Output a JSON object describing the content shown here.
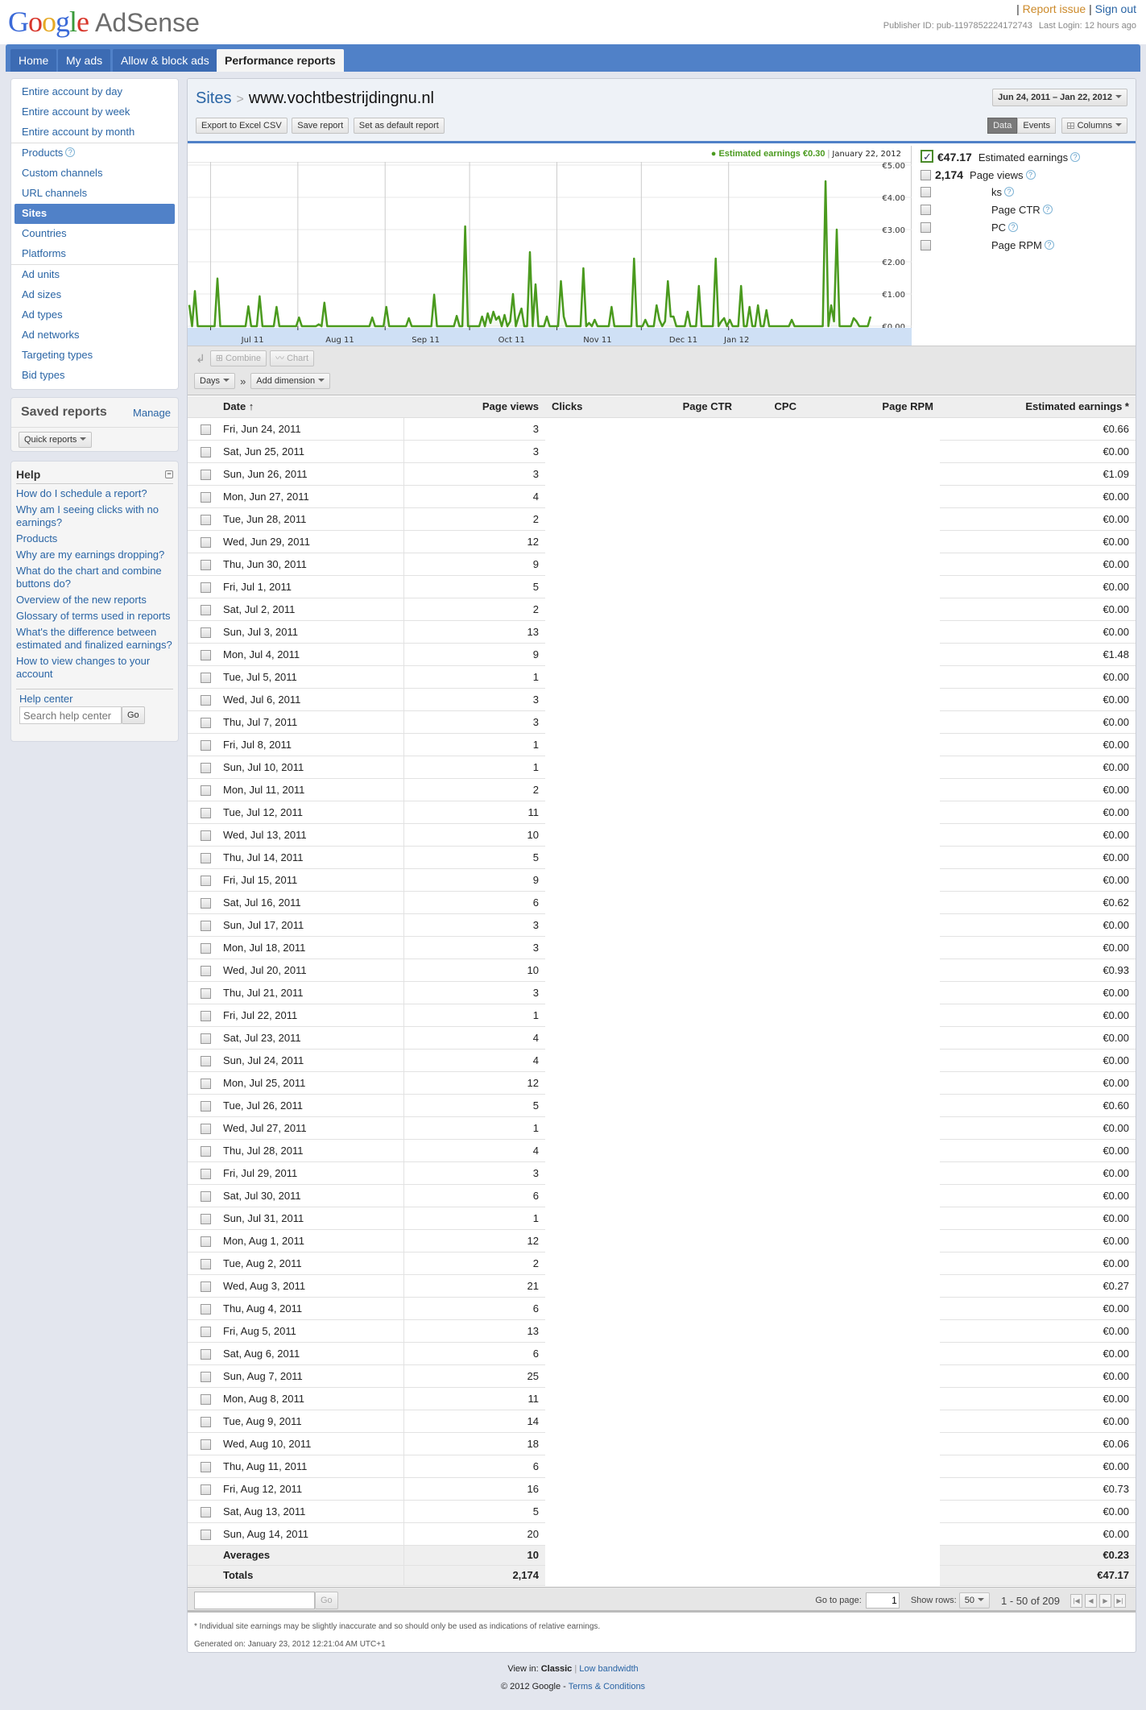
{
  "brand": {
    "google": "Google",
    "product": "AdSense"
  },
  "toplinks": {
    "report_issue": "Report issue",
    "sign_out": "Sign out",
    "publisher_id": "Publisher ID: pub-1197852224172743",
    "last_login": "Last Login: 12 hours ago"
  },
  "tabs": [
    {
      "label": "Home",
      "active": false
    },
    {
      "label": "My ads",
      "active": false
    },
    {
      "label": "Allow & block ads",
      "active": false
    },
    {
      "label": "Performance reports",
      "active": true
    }
  ],
  "sidebar": {
    "groups": [
      [
        "Entire account by day",
        "Entire account by week",
        "Entire account by month"
      ],
      [
        "Products",
        "Custom channels",
        "URL channels",
        "Sites",
        "Countries",
        "Platforms"
      ],
      [
        "Ad units",
        "Ad sizes",
        "Ad types",
        "Ad networks",
        "Targeting types",
        "Bid types"
      ]
    ],
    "active": "Sites",
    "saved_reports": {
      "title": "Saved reports",
      "manage": "Manage",
      "quick_reports": "Quick reports"
    },
    "help": {
      "title": "Help",
      "questions": [
        "How do I schedule a report?",
        "Why am I seeing clicks with no earnings?",
        "Products",
        "Why are my earnings dropping?",
        "What do the chart and combine buttons do?",
        "Overview of the new reports",
        "Glossary of terms used in reports",
        "What's the difference between estimated and finalized earnings?",
        "How to view changes to your account"
      ],
      "help_center": "Help center",
      "search_placeholder": "Search help center",
      "go": "Go"
    }
  },
  "main": {
    "breadcrumb_root": "Sites",
    "breadcrumb_sep": ">",
    "site": "www.vochtbestrijdingnu.nl",
    "actions": [
      "Export to Excel CSV",
      "Save report",
      "Set as default report"
    ],
    "date_range": "Jun 24, 2011 – Jan 22, 2012",
    "view_toggle": [
      "Data",
      "Events"
    ],
    "columns": "Columns",
    "chart_tooltip": {
      "label": "Estimated earnings €0.30",
      "date": "January 22, 2012"
    },
    "metrics": [
      {
        "value": "€47.17",
        "label": "Estimated earnings",
        "checked": true
      },
      {
        "value": "2,174",
        "label": "Page views",
        "checked": false
      },
      {
        "value": "",
        "label": "ks",
        "checked": false
      },
      {
        "value": "",
        "label": "Page CTR",
        "checked": false
      },
      {
        "value": "",
        "label": "PC",
        "checked": false
      },
      {
        "value": "",
        "label": "Page RPM",
        "checked": false
      }
    ],
    "toolbar": {
      "combine": "Combine",
      "chart": "Chart",
      "dimension": "Days",
      "sep": "»",
      "add_dimension": "Add dimension"
    },
    "table": {
      "headers": [
        "Date ↑",
        "Page views",
        "Clicks",
        "Page CTR",
        "CPC",
        "Page RPM",
        "Estimated earnings *"
      ],
      "rows": [
        [
          "Fri, Jun 24, 2011",
          "3",
          "€0.66"
        ],
        [
          "Sat, Jun 25, 2011",
          "3",
          "€0.00"
        ],
        [
          "Sun, Jun 26, 2011",
          "3",
          "€1.09"
        ],
        [
          "Mon, Jun 27, 2011",
          "4",
          "€0.00"
        ],
        [
          "Tue, Jun 28, 2011",
          "2",
          "€0.00"
        ],
        [
          "Wed, Jun 29, 2011",
          "12",
          "€0.00"
        ],
        [
          "Thu, Jun 30, 2011",
          "9",
          "€0.00"
        ],
        [
          "Fri, Jul 1, 2011",
          "5",
          "€0.00"
        ],
        [
          "Sat, Jul 2, 2011",
          "2",
          "€0.00"
        ],
        [
          "Sun, Jul 3, 2011",
          "13",
          "€0.00"
        ],
        [
          "Mon, Jul 4, 2011",
          "9",
          "€1.48"
        ],
        [
          "Tue, Jul 5, 2011",
          "1",
          "€0.00"
        ],
        [
          "Wed, Jul 6, 2011",
          "3",
          "€0.00"
        ],
        [
          "Thu, Jul 7, 2011",
          "3",
          "€0.00"
        ],
        [
          "Fri, Jul 8, 2011",
          "1",
          "€0.00"
        ],
        [
          "Sun, Jul 10, 2011",
          "1",
          "€0.00"
        ],
        [
          "Mon, Jul 11, 2011",
          "2",
          "€0.00"
        ],
        [
          "Tue, Jul 12, 2011",
          "11",
          "€0.00"
        ],
        [
          "Wed, Jul 13, 2011",
          "10",
          "€0.00"
        ],
        [
          "Thu, Jul 14, 2011",
          "5",
          "€0.00"
        ],
        [
          "Fri, Jul 15, 2011",
          "9",
          "€0.00"
        ],
        [
          "Sat, Jul 16, 2011",
          "6",
          "€0.62"
        ],
        [
          "Sun, Jul 17, 2011",
          "3",
          "€0.00"
        ],
        [
          "Mon, Jul 18, 2011",
          "3",
          "€0.00"
        ],
        [
          "Wed, Jul 20, 2011",
          "10",
          "€0.93"
        ],
        [
          "Thu, Jul 21, 2011",
          "3",
          "€0.00"
        ],
        [
          "Fri, Jul 22, 2011",
          "1",
          "€0.00"
        ],
        [
          "Sat, Jul 23, 2011",
          "4",
          "€0.00"
        ],
        [
          "Sun, Jul 24, 2011",
          "4",
          "€0.00"
        ],
        [
          "Mon, Jul 25, 2011",
          "12",
          "€0.00"
        ],
        [
          "Tue, Jul 26, 2011",
          "5",
          "€0.60"
        ],
        [
          "Wed, Jul 27, 2011",
          "1",
          "€0.00"
        ],
        [
          "Thu, Jul 28, 2011",
          "4",
          "€0.00"
        ],
        [
          "Fri, Jul 29, 2011",
          "3",
          "€0.00"
        ],
        [
          "Sat, Jul 30, 2011",
          "6",
          "€0.00"
        ],
        [
          "Sun, Jul 31, 2011",
          "1",
          "€0.00"
        ],
        [
          "Mon, Aug 1, 2011",
          "12",
          "€0.00"
        ],
        [
          "Tue, Aug 2, 2011",
          "2",
          "€0.00"
        ],
        [
          "Wed, Aug 3, 2011",
          "21",
          "€0.27"
        ],
        [
          "Thu, Aug 4, 2011",
          "6",
          "€0.00"
        ],
        [
          "Fri, Aug 5, 2011",
          "13",
          "€0.00"
        ],
        [
          "Sat, Aug 6, 2011",
          "6",
          "€0.00"
        ],
        [
          "Sun, Aug 7, 2011",
          "25",
          "€0.00"
        ],
        [
          "Mon, Aug 8, 2011",
          "11",
          "€0.00"
        ],
        [
          "Tue, Aug 9, 2011",
          "14",
          "€0.00"
        ],
        [
          "Wed, Aug 10, 2011",
          "18",
          "€0.06"
        ],
        [
          "Thu, Aug 11, 2011",
          "6",
          "€0.00"
        ],
        [
          "Fri, Aug 12, 2011",
          "16",
          "€0.73"
        ],
        [
          "Sat, Aug 13, 2011",
          "5",
          "€0.00"
        ],
        [
          "Sun, Aug 14, 2011",
          "20",
          "€0.00"
        ]
      ],
      "averages": {
        "label": "Averages",
        "page_views": "10",
        "earnings": "€0.23"
      },
      "totals": {
        "label": "Totals",
        "page_views": "2,174",
        "earnings": "€47.17"
      }
    },
    "pager": {
      "go": "Go",
      "goto_label": "Go to page:",
      "page": "1",
      "rows_label": "Show rows:",
      "rows": "50",
      "range": "1 - 50 of 209"
    },
    "footnote": "* Individual site earnings may be slightly inaccurate and so should only be used as indications of relative earnings.",
    "generated": "Generated on: January 23, 2012 12:21:04 AM UTC+1"
  },
  "footer": {
    "view_in": "View in:",
    "classic": "Classic",
    "low_bandwidth": "Low bandwidth",
    "copyright": "© 2012 Google -",
    "terms": "Terms & Conditions"
  },
  "chart_data": {
    "type": "line",
    "title": "",
    "series": [
      {
        "name": "Estimated earnings",
        "color": "#4a9a1e"
      }
    ],
    "x_tick_labels": [
      "Jul 11",
      "Aug 11",
      "Sep 11",
      "Oct 11",
      "Nov 11",
      "Dec 11",
      "Jan 12"
    ],
    "y_tick_labels": [
      "€0.00",
      "€1.00",
      "€2.00",
      "€3.00",
      "€4.00",
      "€5.00"
    ],
    "ylim": [
      0,
      5
    ],
    "x_range": [
      "Jun 24, 2011",
      "Jan 22, 2012"
    ],
    "values": [
      0.66,
      0,
      1.09,
      0,
      0,
      0,
      0,
      0,
      0,
      0,
      1.48,
      0,
      0,
      0,
      0,
      0,
      0,
      0,
      0,
      0,
      0,
      0.62,
      0,
      0,
      0,
      0.93,
      0,
      0,
      0,
      0,
      0,
      0.6,
      0,
      0,
      0,
      0,
      0,
      0,
      0,
      0.27,
      0,
      0,
      0,
      0,
      0,
      0,
      0.06,
      0,
      0.73,
      0,
      0,
      0,
      0,
      0,
      0,
      0,
      0,
      0,
      0,
      0,
      0,
      0,
      0,
      0,
      0,
      0.27,
      0,
      0,
      0,
      0,
      0.6,
      0,
      0,
      0,
      0,
      0,
      0,
      0,
      0.25,
      0,
      0,
      0,
      0,
      0,
      0,
      0,
      0,
      0.98,
      0,
      0,
      0,
      0,
      0,
      0,
      0,
      0.32,
      0,
      0,
      3.1,
      0,
      0,
      0,
      0,
      0,
      0.3,
      0,
      0.4,
      0.1,
      0.45,
      0.2,
      0.3,
      0,
      0.35,
      0,
      0.15,
      1.0,
      0,
      0.3,
      0.55,
      0,
      0,
      2.3,
      0,
      1.3,
      0,
      0,
      0,
      0.3,
      0,
      0,
      0,
      0,
      1.4,
      0.3,
      0,
      0,
      0,
      0,
      0,
      0,
      1.8,
      0,
      0.1,
      0,
      0.2,
      0,
      0,
      0,
      0,
      0,
      0.6,
      0,
      0,
      0,
      0,
      0,
      0,
      0,
      2.1,
      0,
      0,
      0,
      0.2,
      0,
      0,
      0,
      0.65,
      0.2,
      0,
      0.15,
      1.4,
      0.3,
      0.3,
      0,
      0,
      0,
      0,
      0.45,
      0,
      0,
      0,
      1.25,
      0,
      0,
      0,
      0,
      0,
      2.1,
      0,
      0.15,
      0.25,
      0,
      0.2,
      0,
      0,
      0,
      1.25,
      0,
      0,
      0.6,
      0,
      0,
      0.65,
      0,
      0,
      0.5,
      0,
      0,
      0,
      0,
      0,
      0,
      0,
      0,
      0.2,
      0,
      0,
      0,
      0,
      0,
      0,
      0,
      0,
      0,
      0,
      0,
      4.5,
      0,
      0.65,
      0.15,
      3.0,
      0,
      0,
      0,
      0,
      0,
      0.25,
      0.15,
      0,
      0,
      0,
      0,
      0.3
    ]
  }
}
